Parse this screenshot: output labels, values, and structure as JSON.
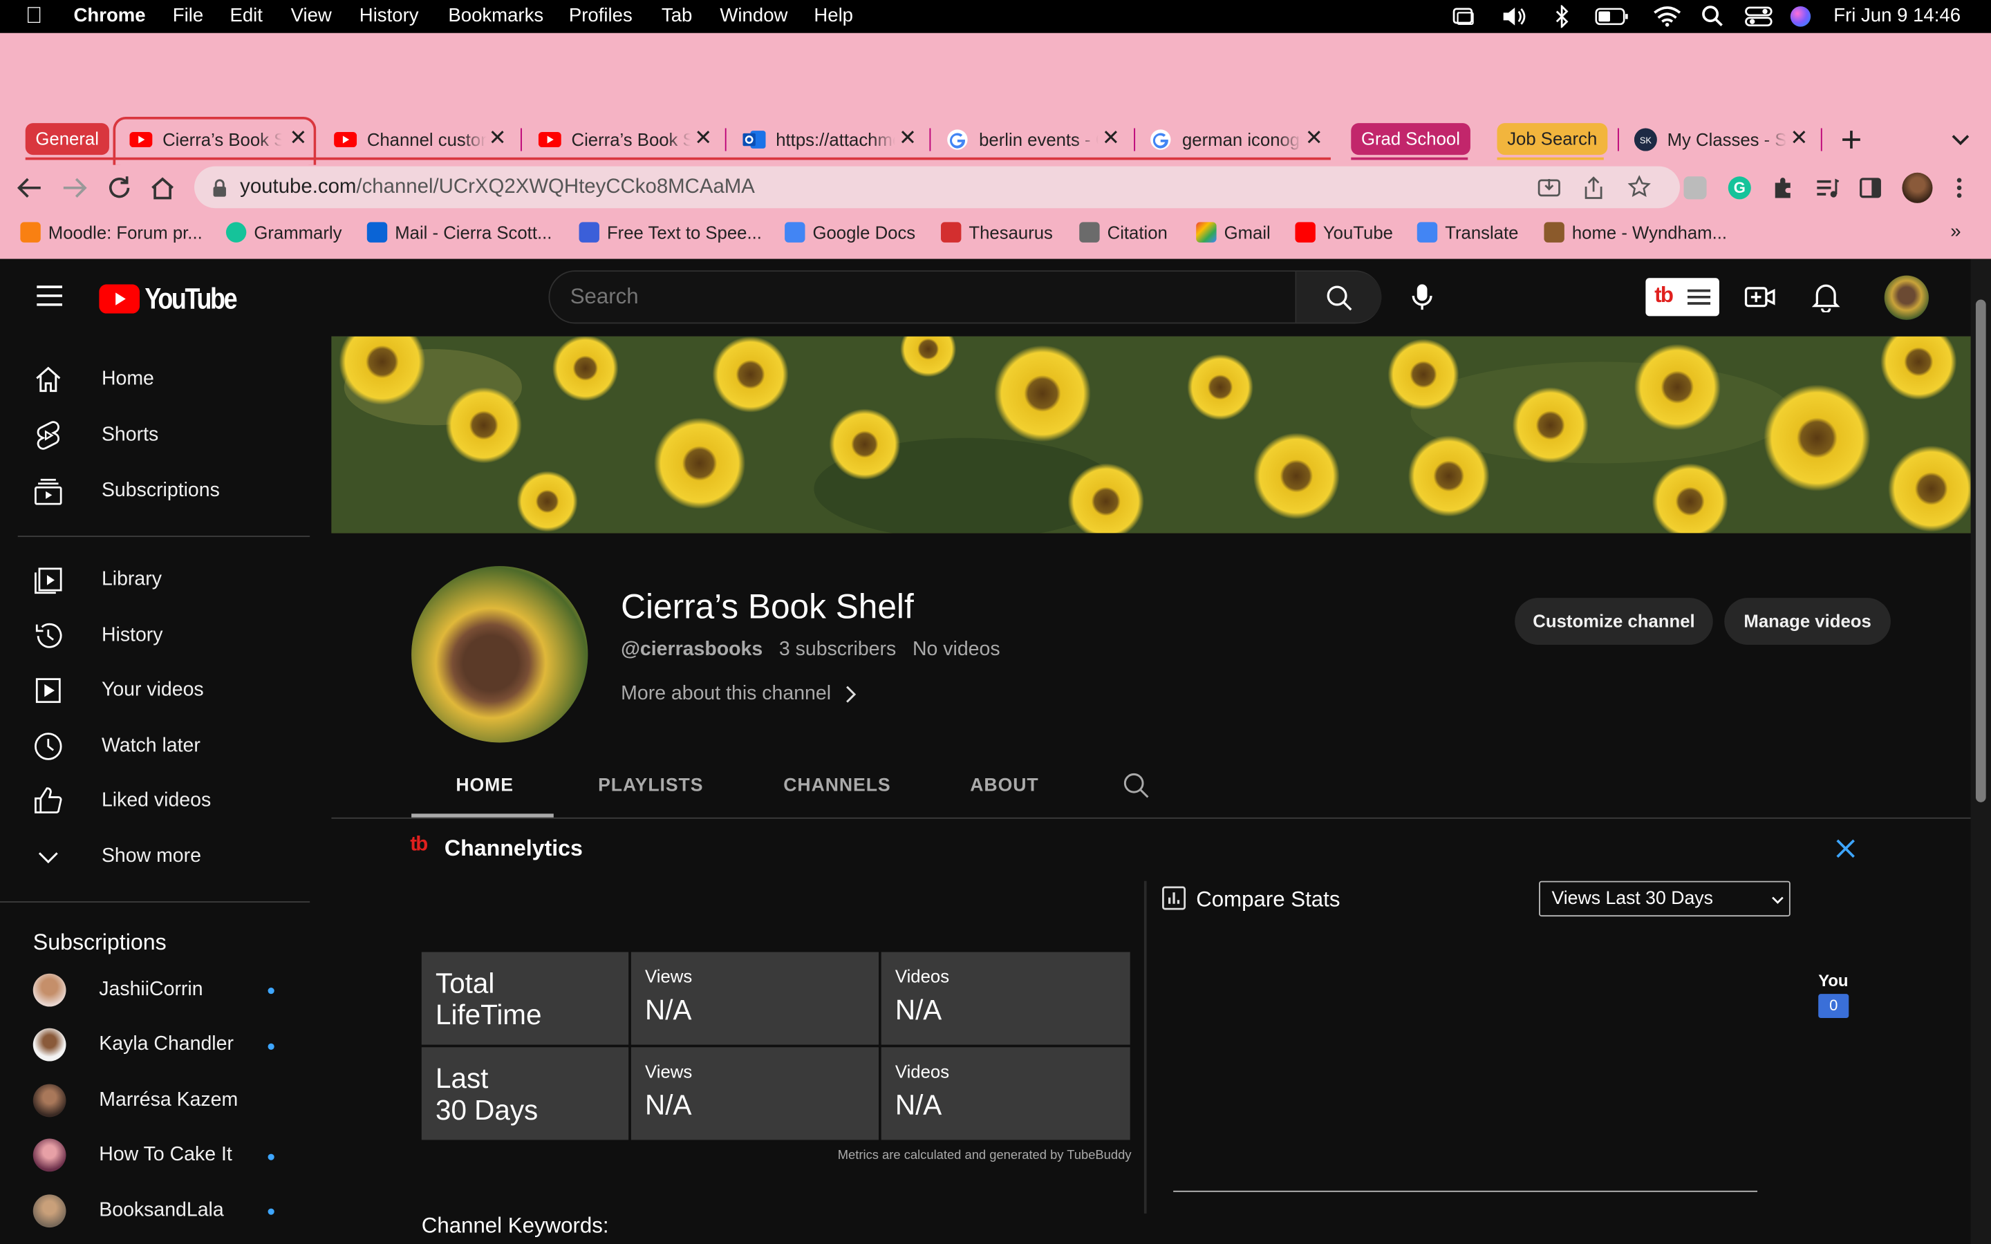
{
  "menubar": {
    "app": "Chrome",
    "items": [
      "File",
      "Edit",
      "View",
      "History",
      "Bookmarks",
      "Profiles",
      "Tab",
      "Window",
      "Help"
    ],
    "datetime": "Fri Jun 9  14:46"
  },
  "tabs": {
    "group_general": "General",
    "tab1": "Cierra’s Book Shelf",
    "tab2": "Channel customization",
    "tab3": "Cierra’s Book Shelf",
    "tab4": "https://attachments",
    "tab5": "berlin events - Google",
    "tab6": "german iconography",
    "group_grad": "Grad School",
    "group_job": "Job Search",
    "tab7": "My Classes - SK"
  },
  "omnibox": {
    "host": "youtube.com",
    "path": "/channel/UCrXQ2XWQHteyCCko8MCAaMA"
  },
  "bookmarks": [
    "Moodle: Forum pr...",
    "Grammarly",
    "Mail - Cierra Scott...",
    "Free Text to Spee...",
    "Google Docs",
    "Thesaurus",
    "Citation",
    "Gmail",
    "YouTube",
    "Translate",
    "home - Wyndham..."
  ],
  "youtube": {
    "logo": "YouTube",
    "search_placeholder": "Search",
    "nav": [
      {
        "label": "Home",
        "icon": "home-icon"
      },
      {
        "label": "Shorts",
        "icon": "shorts-icon"
      },
      {
        "label": "Subscriptions",
        "icon": "subscriptions-icon"
      },
      {
        "label": "Library",
        "icon": "library-icon"
      },
      {
        "label": "History",
        "icon": "history-icon"
      },
      {
        "label": "Your videos",
        "icon": "your-videos-icon"
      },
      {
        "label": "Watch later",
        "icon": "watch-later-icon"
      },
      {
        "label": "Liked videos",
        "icon": "liked-videos-icon"
      },
      {
        "label": "Show more",
        "icon": "chevron-down-icon"
      }
    ],
    "subscriptions_title": "Subscriptions",
    "subscriptions": [
      {
        "name": "JashiiCorrin",
        "new": true
      },
      {
        "name": "Kayla Chandler",
        "new": true
      },
      {
        "name": "Marrésa Kazem",
        "new": false
      },
      {
        "name": "How To Cake It",
        "new": true
      },
      {
        "name": "BooksandLala",
        "new": true
      }
    ]
  },
  "channel": {
    "name": "Cierra’s Book Shelf",
    "handle": "@cierrasbooks",
    "subscribers": "3 subscribers",
    "videos": "No videos",
    "more_about": "More about this channel",
    "customize_button": "Customize channel",
    "manage_button": "Manage videos",
    "tabs": [
      "HOME",
      "PLAYLISTS",
      "CHANNELS",
      "ABOUT"
    ],
    "active_tab": "HOME"
  },
  "channelytics": {
    "title": "Channelytics",
    "rows": [
      {
        "label": "Total LifeTime",
        "label_line1": "Total",
        "label_line2": "LifeTime",
        "views_label": "Views",
        "views": "N/A",
        "videos_label": "Videos",
        "videos": "N/A"
      },
      {
        "label": "Last 30 Days",
        "label_line1": "Last",
        "label_line2": "30 Days",
        "views_label": "Views",
        "views": "N/A",
        "videos_label": "Videos",
        "videos": "N/A"
      }
    ],
    "footnote": "Metrics are calculated and generated by TubeBuddy",
    "keywords_label": "Channel Keywords:",
    "compare_title": "Compare Stats",
    "compare_select": "Views Last 30 Days",
    "you_label": "You",
    "you_value": "0"
  },
  "colors": {
    "chrome_bg": "#f5b3c4",
    "youtube_red": "#ff0000",
    "dark_bg": "#0f0f0f",
    "link_blue": "#3ea6ff",
    "tag_general": "#d9363e",
    "tag_grad": "#c2266b",
    "tag_job": "#f2b53d"
  }
}
